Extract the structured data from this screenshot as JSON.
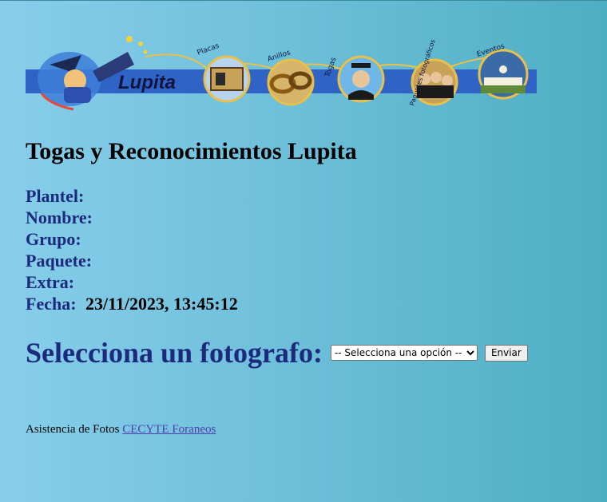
{
  "banner": {
    "brand": "Lupita",
    "sections": [
      "Placas",
      "Anillos",
      "Togas",
      "Paquetes fotográficos",
      "Eventos"
    ],
    "colors": {
      "band": "#2f63c6",
      "gold": "#e8c04a"
    }
  },
  "page": {
    "title": "Togas y Reconocimientos Lupita"
  },
  "fields": {
    "plantel": {
      "label": "Plantel:",
      "value": ""
    },
    "nombre": {
      "label": "Nombre:",
      "value": ""
    },
    "grupo": {
      "label": "Grupo:",
      "value": ""
    },
    "paquete": {
      "label": "Paquete:",
      "value": ""
    },
    "extra": {
      "label": "Extra:",
      "value": ""
    },
    "fecha": {
      "label": "Fecha:",
      "value": "23/11/2023, 13:45:12"
    }
  },
  "selector": {
    "label": "Selecciona un fotografo:",
    "selected_option": "-- Selecciona una opción --",
    "submit_label": "Enviar"
  },
  "footer": {
    "text": "Asistencia de Fotos",
    "link_text": "CECYTE Foraneos"
  }
}
